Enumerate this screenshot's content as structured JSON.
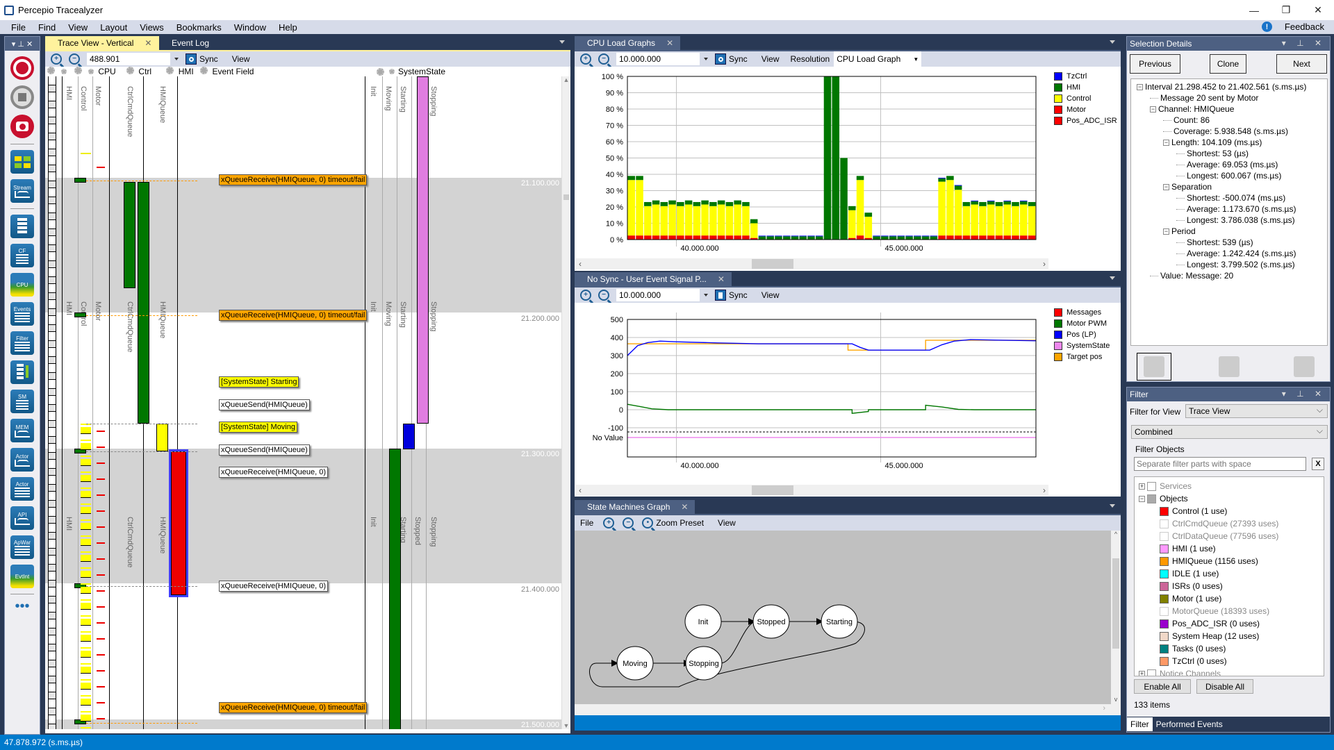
{
  "window": {
    "title": "Percepio Tracealyzer",
    "minimize": "—",
    "restore": "❐",
    "close": "✕"
  },
  "menu": [
    "File",
    "Find",
    "View",
    "Layout",
    "Views",
    "Bookmarks",
    "Window",
    "Help"
  ],
  "feedback": {
    "icon": "!",
    "label": "Feedback"
  },
  "toolbox": {
    "header_controls": "▾ ⊥ ✕",
    "items": [
      {
        "icon": "record-icon",
        "label": ""
      },
      {
        "icon": "stop-icon",
        "label": ""
      },
      {
        "icon": "snapshot-icon",
        "label": ""
      },
      {
        "icon": "dashboard-icon",
        "label": ""
      },
      {
        "icon": "stream-icon",
        "label": "Stream"
      },
      {
        "icon": "trace-view-icon",
        "label": ""
      },
      {
        "icon": "communication-flow-icon",
        "label": "CF"
      },
      {
        "icon": "cpu-load-icon",
        "label": "CPU"
      },
      {
        "icon": "events-icon",
        "label": "Events"
      },
      {
        "icon": "filter-icon",
        "label": "Filter"
      },
      {
        "icon": "trace-view-annotated-icon",
        "label": ""
      },
      {
        "icon": "state-machine-icon",
        "label": "SM"
      },
      {
        "icon": "memory-icon",
        "label": "MEM"
      },
      {
        "icon": "actor-plot-icon",
        "label": "Actor"
      },
      {
        "icon": "actor-list-icon",
        "label": "Actor"
      },
      {
        "icon": "api-plot-icon",
        "label": "API"
      },
      {
        "icon": "app-warnings-icon",
        "label": "ApWar"
      },
      {
        "icon": "event-intensity-icon",
        "label": "EvtInt"
      },
      {
        "icon": "more-icon",
        "label": "•••"
      }
    ]
  },
  "trace_view": {
    "tabs": [
      {
        "label": "Trace View - Vertical",
        "close": "✕"
      },
      {
        "label": "Event Log"
      }
    ],
    "zoom_value": "488.901",
    "sync_label": "Sync",
    "view_label": "View",
    "column_groups": [
      "CPU",
      "Ctrl",
      "HMI",
      "Event Field",
      "SystemState"
    ],
    "columns": [
      "HMI",
      "Control",
      "Motor",
      "CtrlCmdQueue",
      "HMIQueue",
      "Init",
      "Moving",
      "Starting",
      "Stopped",
      "Stopping"
    ],
    "timestamps": [
      "21.100.000",
      "21.200.000",
      "21.300.000",
      "21.400.000",
      "21.500.000"
    ],
    "event_labels": [
      {
        "text": "xQueueReceive(HMIQueue, 0) timeout/fail",
        "style": "orange"
      },
      {
        "text": "xQueueReceive(HMIQueue, 0) timeout/fail",
        "style": "orange"
      },
      {
        "text": "[SystemState] Starting",
        "style": "yellow"
      },
      {
        "text": "xQueueSend(HMIQueue)",
        "style": "white"
      },
      {
        "text": "[SystemState] Moving",
        "style": "yellow"
      },
      {
        "text": "xQueueSend(HMIQueue)",
        "style": "white"
      },
      {
        "text": "xQueueReceive(HMIQueue, 0)",
        "style": "white"
      },
      {
        "text": "xQueueReceive(HMIQueue, 0)",
        "style": "white"
      },
      {
        "text": "xQueueReceive(HMIQueue, 0) timeout/fail",
        "style": "orange"
      }
    ]
  },
  "cpu_load": {
    "tab": "CPU Load Graphs",
    "zoom_value": "10.000.000",
    "sync_label": "Sync",
    "view_label": "View",
    "resolution_label": "Resolution",
    "graph_type": "CPU Load Graph"
  },
  "signal_plot": {
    "tab": "No Sync - User Event Signal P...",
    "zoom_value": "10.000.000",
    "sync_label": "Sync",
    "view_label": "View"
  },
  "state_machine": {
    "tab": "State Machines Graph",
    "file_label": "File",
    "zoom_preset_label": "Zoom Preset",
    "view_label": "View",
    "states": [
      "Init",
      "Stopped",
      "Starting",
      "Moving",
      "Stopping"
    ]
  },
  "selection_details": {
    "title": "Selection Details",
    "header_controls": "▾ ⊥ ✕",
    "buttons": {
      "previous": "Previous",
      "clone": "Clone",
      "next": "Next"
    },
    "tree": [
      {
        "level": 0,
        "toggle": "−",
        "text": "Interval 21.298.452 to 21.402.561 (s.ms.µs)"
      },
      {
        "level": 1,
        "toggle": "",
        "text": "Message 20 sent by Motor"
      },
      {
        "level": 1,
        "toggle": "−",
        "text": "Channel: HMIQueue"
      },
      {
        "level": 2,
        "toggle": "",
        "text": "Count: 86"
      },
      {
        "level": 2,
        "toggle": "",
        "text": "Coverage: 5.938.548 (s.ms.µs)"
      },
      {
        "level": 2,
        "toggle": "−",
        "text": "Length: 104.109 (ms.µs)"
      },
      {
        "level": 3,
        "toggle": "",
        "text": "Shortest: 53 (µs)"
      },
      {
        "level": 3,
        "toggle": "",
        "text": "Average: 69.053 (ms.µs)"
      },
      {
        "level": 3,
        "toggle": "",
        "text": "Longest: 600.067 (ms.µs)"
      },
      {
        "level": 2,
        "toggle": "−",
        "text": "Separation"
      },
      {
        "level": 3,
        "toggle": "",
        "text": "Shortest: -500.074 (ms.µs)"
      },
      {
        "level": 3,
        "toggle": "",
        "text": "Average: 1.173.670 (s.ms.µs)"
      },
      {
        "level": 3,
        "toggle": "",
        "text": "Longest: 3.786.038 (s.ms.µs)"
      },
      {
        "level": 2,
        "toggle": "−",
        "text": "Period"
      },
      {
        "level": 3,
        "toggle": "",
        "text": "Shortest: 539 (µs)"
      },
      {
        "level": 3,
        "toggle": "",
        "text": "Average: 1.242.424 (s.ms.µs)"
      },
      {
        "level": 3,
        "toggle": "",
        "text": "Longest: 3.799.502 (s.ms.µs)"
      },
      {
        "level": 1,
        "toggle": "",
        "text": "Value: Message: 20"
      }
    ],
    "view_icons": [
      "horizontal-trace-icon",
      "vertical-trace-icon",
      "split-trace-icon"
    ]
  },
  "filter": {
    "title": "Filter",
    "header_controls": "▾ ⊥ ✕",
    "filter_for_view_label": "Filter for View",
    "filter_for_view_value": "Trace View",
    "mode_value": "Combined",
    "filter_objects_label": "Filter Objects",
    "search_placeholder": "Separate filter parts with space",
    "clear_label": "X",
    "groups": [
      {
        "toggle": "+",
        "label": "Services",
        "dim": true
      },
      {
        "toggle": "−",
        "label": "Objects",
        "dim": false
      }
    ],
    "objects": [
      {
        "label": "Control (1 use)",
        "color": "#ff0000",
        "dim": false
      },
      {
        "label": "CtrlCmdQueue (27393 uses)",
        "color": "#ffffff",
        "dim": true
      },
      {
        "label": "CtrlDataQueue (77596 uses)",
        "color": "#ffffff",
        "dim": true
      },
      {
        "label": "HMI (1 use)",
        "color": "#ff99ff",
        "dim": false
      },
      {
        "label": "HMIQueue (1156 uses)",
        "color": "#ff9900",
        "dim": false
      },
      {
        "label": "IDLE (1 use)",
        "color": "#00ffff",
        "dim": false
      },
      {
        "label": "ISRs (0 uses)",
        "color": "#cc6699",
        "dim": false
      },
      {
        "label": "Motor (1 use)",
        "color": "#808000",
        "dim": false
      },
      {
        "label": "MotorQueue (18393 uses)",
        "color": "#ffffff",
        "dim": true
      },
      {
        "label": "Pos_ADC_ISR (0 uses)",
        "color": "#9900cc",
        "dim": false
      },
      {
        "label": "System Heap (12 uses)",
        "color": "#f0d8c8",
        "dim": false
      },
      {
        "label": "Tasks (0 uses)",
        "color": "#008080",
        "dim": false
      },
      {
        "label": "TzCtrl (0 uses)",
        "color": "#ff9966",
        "dim": false
      }
    ],
    "notice_channels": {
      "toggle": "+",
      "label": "Notice Channels"
    },
    "enable_all": "Enable All",
    "disable_all": "Disable All",
    "count": "133 items",
    "bottom_tabs": [
      "Filter",
      "Performed Events"
    ]
  },
  "status_bar": {
    "text": "47.878.972 (s.ms.µs)"
  },
  "chart_data": [
    {
      "type": "bar",
      "title": "CPU Load Graph",
      "stacked": true,
      "xlabel": "",
      "ylabel": "",
      "ylim": [
        0,
        100
      ],
      "yticks": [
        "0 %",
        "10 %",
        "20 %",
        "30 %",
        "40 %",
        "50 %",
        "60 %",
        "70 %",
        "80 %",
        "90 %",
        "100 %"
      ],
      "xticks": [
        {
          "value": 40000000,
          "label": "40.000.000"
        },
        {
          "value": 45000000,
          "label": "45.000.000"
        }
      ],
      "xlim": [
        38800000,
        48800000
      ],
      "grid": true,
      "legend": "right",
      "legend_entries": [
        {
          "name": "TzCtrl",
          "color": "#0000ff"
        },
        {
          "name": "HMI",
          "color": "#007700"
        },
        {
          "name": "Control",
          "color": "#ffff00"
        },
        {
          "name": "Motor",
          "color": "#ff0000"
        },
        {
          "name": "Pos_ADC_ISR",
          "color": "#ff0000"
        }
      ],
      "bar_count": 50,
      "series": [
        {
          "name": "Motor",
          "values": [
            2.5,
            2.5,
            2.5,
            2.5,
            2.5,
            2.5,
            2.5,
            2.5,
            2.5,
            2.5,
            2.5,
            2.5,
            2.5,
            2.5,
            2.5,
            1,
            0,
            0,
            0,
            0,
            0,
            0,
            0,
            0,
            0,
            0,
            0,
            1,
            2.5,
            1,
            0,
            0,
            0,
            0,
            0,
            0,
            0,
            0,
            2.5,
            2.5,
            2.5,
            2.5,
            2.5,
            2.5,
            2.5,
            2.5,
            2.5,
            2.5,
            2.5,
            2.5
          ]
        },
        {
          "name": "Control",
          "values": [
            34,
            34,
            18,
            19,
            18,
            19,
            18,
            19,
            18,
            19,
            18,
            19,
            18,
            19,
            18,
            9,
            0,
            0,
            0,
            0,
            0,
            0,
            0,
            0,
            0,
            0,
            0,
            17,
            34,
            13,
            0,
            0,
            0,
            0,
            0,
            0,
            0,
            0,
            33,
            34,
            28,
            18,
            19,
            18,
            19,
            18,
            19,
            18,
            19,
            18
          ]
        },
        {
          "name": "HMI",
          "values": [
            2.5,
            2.5,
            2.5,
            2.5,
            2.5,
            2.5,
            2.5,
            2.5,
            2.5,
            2.5,
            2.5,
            2.5,
            2.5,
            2.5,
            2.5,
            2.5,
            2,
            2,
            2,
            2,
            2,
            2,
            2,
            2,
            100,
            100,
            50,
            2.5,
            2.5,
            2.5,
            2,
            2,
            2,
            2,
            2,
            2,
            2,
            2,
            2,
            2.5,
            2.5,
            2.5,
            2,
            2.5,
            2,
            2.5,
            2,
            2.5,
            2,
            2.5
          ]
        },
        {
          "name": "TzCtrl",
          "values": [
            0,
            0,
            0,
            0,
            0,
            0,
            0,
            0,
            0,
            0,
            0,
            0,
            0,
            0,
            0,
            0,
            0.4,
            0.4,
            0.4,
            0.4,
            0.4,
            0.4,
            0.4,
            0.4,
            0,
            0,
            0,
            0,
            0,
            0,
            0.4,
            0.4,
            0.4,
            0.4,
            0.4,
            0.4,
            0.4,
            0.4,
            0.4,
            0,
            0.4,
            0,
            0.4,
            0,
            0.4,
            0,
            0.4,
            0,
            0.4,
            0
          ]
        }
      ]
    },
    {
      "type": "line",
      "title": "User Event Signal Plot",
      "xlabel": "",
      "ylabel": "",
      "ylim": [
        -100,
        500
      ],
      "yticks": [
        "500",
        "400",
        "300",
        "200",
        "100",
        "0",
        "-100",
        "No Value"
      ],
      "xticks": [
        {
          "value": 40000000,
          "label": "40.000.000"
        },
        {
          "value": 45000000,
          "label": "45.000.000"
        }
      ],
      "xlim": [
        38800000,
        48800000
      ],
      "grid": true,
      "legend": "right",
      "legend_entries": [
        {
          "name": "Messages",
          "color": "#ff0000"
        },
        {
          "name": "Motor PWM",
          "color": "#007700"
        },
        {
          "name": "Pos (LP)",
          "color": "#0000ff"
        },
        {
          "name": "SystemState",
          "color": "#ee88ee"
        },
        {
          "name": "Target pos",
          "color": "#ffa500"
        }
      ],
      "series": [
        {
          "name": "Pos (LP)",
          "color": "#0000ff",
          "points": [
            [
              38800000,
              300
            ],
            [
              39050000,
              355
            ],
            [
              39300000,
              372
            ],
            [
              39600000,
              380
            ],
            [
              40000000,
              376
            ],
            [
              41000000,
              370
            ],
            [
              42000000,
              365
            ],
            [
              43000000,
              365
            ],
            [
              44300000,
              365
            ],
            [
              44500000,
              345
            ],
            [
              44700000,
              330
            ],
            [
              46200000,
              330
            ],
            [
              46500000,
              360
            ],
            [
              46800000,
              380
            ],
            [
              47200000,
              388
            ],
            [
              48000000,
              385
            ],
            [
              48800000,
              382
            ]
          ]
        },
        {
          "name": "Target pos",
          "color": "#ffa500",
          "points": [
            [
              38800000,
              365
            ],
            [
              44200000,
              365
            ],
            [
              44200000,
              330
            ],
            [
              46100000,
              330
            ],
            [
              46100000,
              385
            ],
            [
              48800000,
              385
            ]
          ]
        },
        {
          "name": "Motor PWM",
          "color": "#007700",
          "points": [
            [
              38800000,
              30
            ],
            [
              39100000,
              18
            ],
            [
              39400000,
              5
            ],
            [
              39800000,
              0
            ],
            [
              44300000,
              0
            ],
            [
              44300000,
              -20
            ],
            [
              44700000,
              -10
            ],
            [
              44700000,
              0
            ],
            [
              46100000,
              0
            ],
            [
              46100000,
              25
            ],
            [
              46500000,
              15
            ],
            [
              46900000,
              2
            ],
            [
              47300000,
              0
            ],
            [
              48800000,
              0
            ]
          ]
        },
        {
          "name": "SystemState",
          "color": "#ee88ee",
          "points": [
            [
              38800000,
              "No Value"
            ],
            [
              48800000,
              "No Value"
            ]
          ]
        }
      ]
    }
  ]
}
